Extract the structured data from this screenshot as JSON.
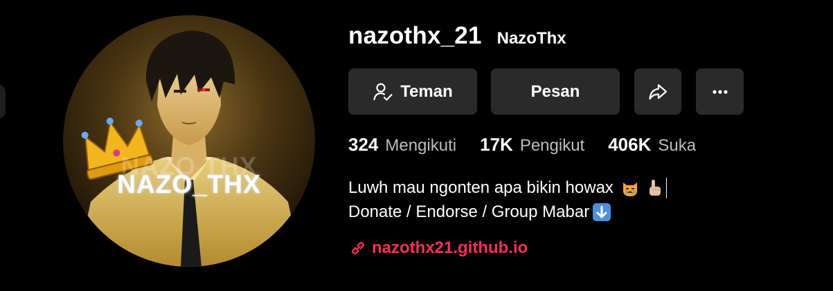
{
  "profile": {
    "username": "nazothx_21",
    "display_name": "NazoThx",
    "avatar_text": "NAZO_THX",
    "avatar_ghost_text": "NAZO THX"
  },
  "actions": {
    "friend_label": "Teman",
    "message_label": "Pesan",
    "share_icon": "share-icon",
    "more_icon": "more-icon"
  },
  "stats": {
    "following_count": "324",
    "following_label": "Mengikuti",
    "followers_count": "17K",
    "followers_label": "Pengikut",
    "likes_count": "406K",
    "likes_label": "Suka"
  },
  "bio": {
    "line1": "Luwh mau ngonten apa bikin howax",
    "line2": "Donate / Endorse / Group Mabar"
  },
  "link": {
    "url_text": "nazothx21.github.io"
  },
  "colors": {
    "background": "#000000",
    "button_bg": "#2a2a2a",
    "link": "#fe2c55",
    "muted_text": "#bdbdbd"
  }
}
